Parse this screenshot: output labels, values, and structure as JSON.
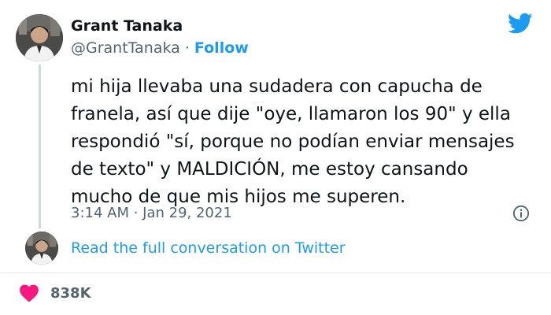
{
  "author": {
    "name": "Grant Tanaka",
    "handle": "@GrantTanaka",
    "separator": "·",
    "follow_label": "Follow"
  },
  "tweet": {
    "text": "mi hija llevaba una sudadera con capucha de\nfranela, así que dije \"oye, llamaron los 90\" y ella\nrespondió \"sí, porque no podían enviar mensajes\nde texto\" y MALDICIÓN, me estoy cansando\nmucho de que mis hijos me superen.",
    "timestamp": "3:14 AM · Jan 29, 2021"
  },
  "conversation_link": "Read the full conversation on Twitter",
  "engagement": {
    "likes": "838K"
  },
  "icons": {
    "brand": "twitter-bird-icon",
    "info": "info-icon",
    "like": "heart-icon"
  },
  "colors": {
    "accent": "#1d9bf0",
    "text": "#0f1419",
    "muted": "#536471",
    "heart": "#f91880",
    "thread_line": "#cfd9de"
  }
}
